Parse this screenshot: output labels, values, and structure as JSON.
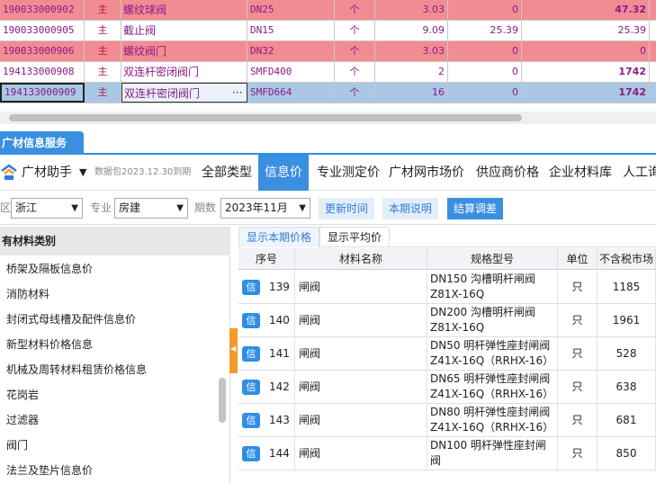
{
  "top_rows": [
    {
      "id": "190033000902",
      "main": "主",
      "name": "螺纹球阀",
      "spec": "DN25",
      "unit": "个",
      "qty": "3.03",
      "price": "0",
      "total": "47.32",
      "style": "pink",
      "bold_total": true
    },
    {
      "id": "190033000905",
      "main": "主",
      "name": "截止阀",
      "spec": "DN15",
      "unit": "个",
      "qty": "9.09",
      "price": "25.39",
      "total": "25.39",
      "style": "white",
      "bold_total": false
    },
    {
      "id": "190033000906",
      "main": "主",
      "name": "螺纹阀门",
      "spec": "DN32",
      "unit": "个",
      "qty": "3.03",
      "price": "0",
      "total": "0",
      "style": "pink",
      "bold_total": false
    },
    {
      "id": "194133000908",
      "main": "主",
      "name": "双连杆密闭阀门",
      "spec": "SMFD400",
      "unit": "个",
      "qty": "2",
      "price": "0",
      "total": "1742",
      "style": "white",
      "bold_total": true
    },
    {
      "id": "194133000909",
      "main": "主",
      "name": "双连杆密闭阀门",
      "spec": "SMFD664",
      "unit": "个",
      "qty": "16",
      "price": "0",
      "total": "1742",
      "style": "blue",
      "bold_total": true,
      "dots": "···"
    }
  ],
  "panel": {
    "tab_title": "广材信息服务"
  },
  "toolbar": {
    "app_name": "广材助手",
    "caret": "▼",
    "package": "数据包2023.12.30到期",
    "tabs": [
      "全部类型",
      "信息价",
      "专业测定价",
      "广材网市场价",
      "供应商价格",
      "企业材料库",
      "人工询"
    ],
    "active_tab": 1
  },
  "filters": {
    "region_label": "区",
    "region": "浙江",
    "major_label": "专业",
    "major": "房建",
    "period_label": "期数",
    "period": "2023年11月",
    "btn_update": "更新时间",
    "btn_desc": "本期说明",
    "btn_adjust": "结算调差"
  },
  "left": {
    "title": "有材料类别",
    "items": [
      "桥架及隔板信息价",
      "消防材料",
      "封闭式母线槽及配件信息价",
      "新型材料价格信息",
      "机械及周转材料租赁价格信息",
      "花岗岩",
      "过滤器",
      "阀门",
      "法兰及垫片信息价"
    ]
  },
  "subtabs": [
    "显示本期价格",
    "显示平均价"
  ],
  "table": {
    "headers": [
      "序号",
      "材料名称",
      "规格型号",
      "单位",
      "不含税市场"
    ],
    "badge": "信",
    "rows": [
      {
        "seq": "139",
        "name": "闸阀",
        "spec": "DN150 沟槽明杆闸阀\nZ81X-16Q",
        "unit": "只",
        "price": "1185"
      },
      {
        "seq": "140",
        "name": "闸阀",
        "spec": "DN200 沟槽明杆闸阀\nZ81X-16Q",
        "unit": "只",
        "price": "1961"
      },
      {
        "seq": "141",
        "name": "闸阀",
        "spec": "DN50 明杆弹性座封闸阀\nZ41X-16Q（RRHX-16）",
        "unit": "只",
        "price": "528"
      },
      {
        "seq": "142",
        "name": "闸阀",
        "spec": "DN65 明杆弹性座封闸阀\nZ41X-16Q（RRHX-16）",
        "unit": "只",
        "price": "638"
      },
      {
        "seq": "143",
        "name": "闸阀",
        "spec": "DN80 明杆弹性座封闸阀\nZ41X-16Q（RRHX-16）",
        "unit": "只",
        "price": "681"
      },
      {
        "seq": "144",
        "name": "闸阀",
        "spec": "DN100 明杆弹性座封闸\n阀",
        "unit": "只",
        "price": "850"
      }
    ]
  },
  "colors": {
    "accent": "#3b8fe0",
    "pink_row": "#f28c93",
    "blue_row": "#aac8e4",
    "orange": "#f39a2a"
  }
}
